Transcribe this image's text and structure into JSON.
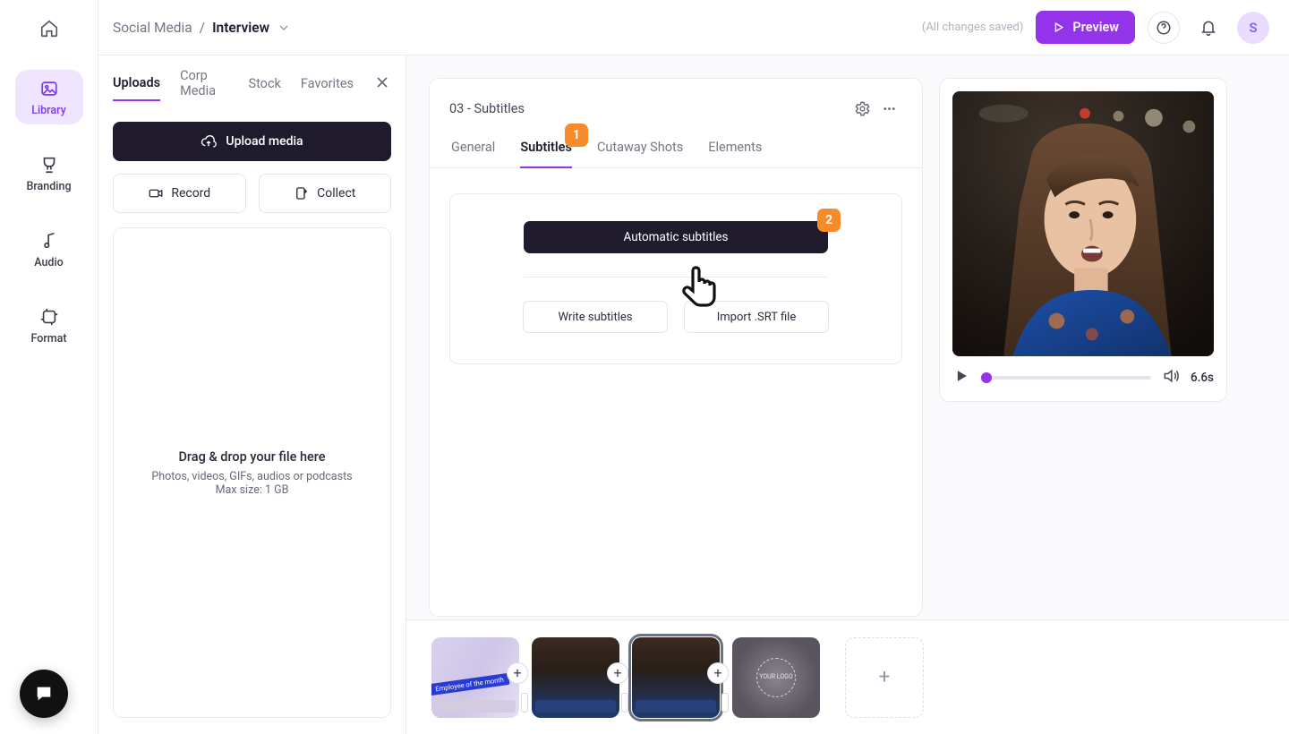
{
  "breadcrumb": {
    "parent": "Social Media",
    "sep": "/",
    "current": "Interview"
  },
  "topbar": {
    "saved_label": "(All changes saved)",
    "preview_label": "Preview",
    "avatar_initial": "S"
  },
  "nav": {
    "items": [
      {
        "label": "Library",
        "active": true
      },
      {
        "label": "Branding",
        "active": false
      },
      {
        "label": "Audio",
        "active": false
      },
      {
        "label": "Format",
        "active": false
      }
    ]
  },
  "panel": {
    "tabs": [
      "Uploads",
      "Corp Media",
      "Stock",
      "Favorites"
    ],
    "active_tab": 0,
    "upload_label": "Upload media",
    "record_label": "Record",
    "collect_label": "Collect",
    "drop_title": "Drag & drop your file here",
    "drop_sub1": "Photos, videos, GIFs, audios or podcasts",
    "drop_sub2": "Max size: 1 GB"
  },
  "editor": {
    "title": "03 - Subtitles",
    "tabs": [
      "General",
      "Subtitles",
      "Cutaway Shots",
      "Elements"
    ],
    "active_tab": 1,
    "callout1": "1",
    "auto_sub_label": "Automatic subtitles",
    "callout2": "2",
    "write_label": "Write subtitles",
    "import_label": "Import .SRT file"
  },
  "preview": {
    "duration": "6.6s"
  },
  "timeline": {
    "clips": [
      {
        "kind": "office",
        "banner": "Employee of the month"
      },
      {
        "kind": "woman"
      },
      {
        "kind": "woman",
        "selected": true
      },
      {
        "kind": "logo",
        "logo_text": "YOUR LOGO"
      }
    ]
  }
}
